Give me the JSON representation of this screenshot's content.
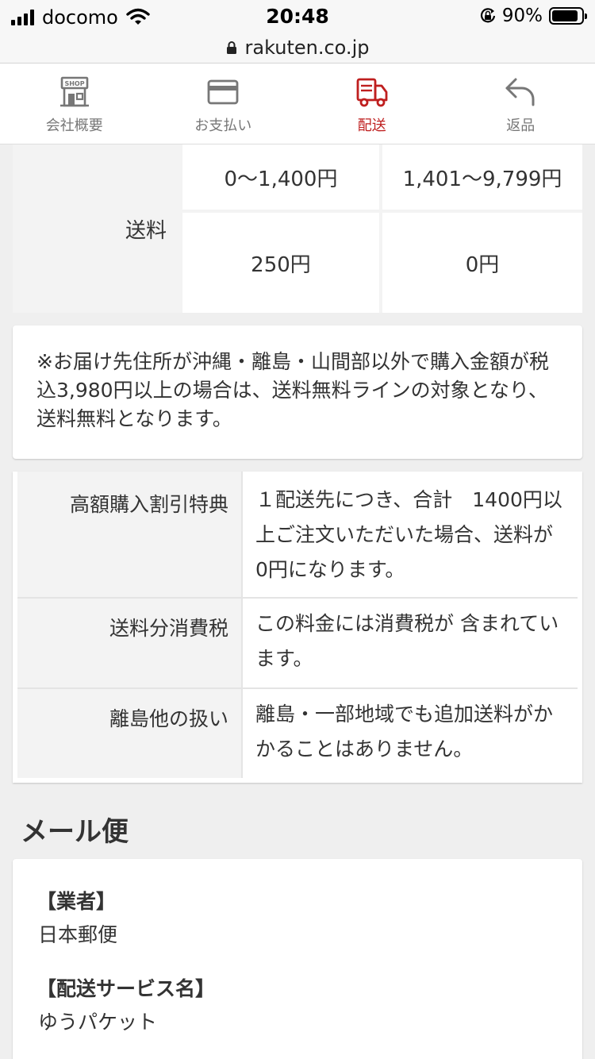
{
  "status_bar": {
    "carrier": "docomo",
    "time": "20:48",
    "battery": "90%",
    "battery_level": 0.9
  },
  "url_bar": {
    "domain": "rakuten.co.jp"
  },
  "tabs": [
    {
      "label": "会社概要",
      "icon": "shop-icon",
      "active": false
    },
    {
      "label": "お支払い",
      "icon": "credit-card-icon",
      "active": false
    },
    {
      "label": "配送",
      "icon": "delivery-truck-icon",
      "active": true
    },
    {
      "label": "返品",
      "icon": "return-arrow-icon",
      "active": false
    }
  ],
  "shipping_table": {
    "row_label": "送料",
    "price_ranges": [
      "0〜1,400円",
      "1,401〜9,799円"
    ],
    "fees": [
      "250円",
      "0円"
    ]
  },
  "note": "※お届け先住所が沖縄・離島・山間部以外で購入金額が税込3,980円以上の場合は、送料無料ラインの対象となり、送料無料となります。",
  "details": [
    {
      "label": "高額購入割引特典",
      "value": "１配送先につき、合計　1400円以上ご注文いただいた場合、送料が　0円になります。"
    },
    {
      "label": "送料分消費税",
      "value": "この料金には消費税が 含まれています。"
    },
    {
      "label": "離島他の扱い",
      "value": "離島・一部地域でも追加送料がかかることはありません。"
    }
  ],
  "mail_section": {
    "title": "メール便",
    "carrier_heading": "【業者】",
    "carrier_value": "日本郵便",
    "service_heading": "【配送サービス名】",
    "service_value": "ゆうパケット"
  },
  "colors": {
    "accent": "#bf1f1f",
    "tab_inactive": "#777777",
    "background": "#efefef"
  }
}
